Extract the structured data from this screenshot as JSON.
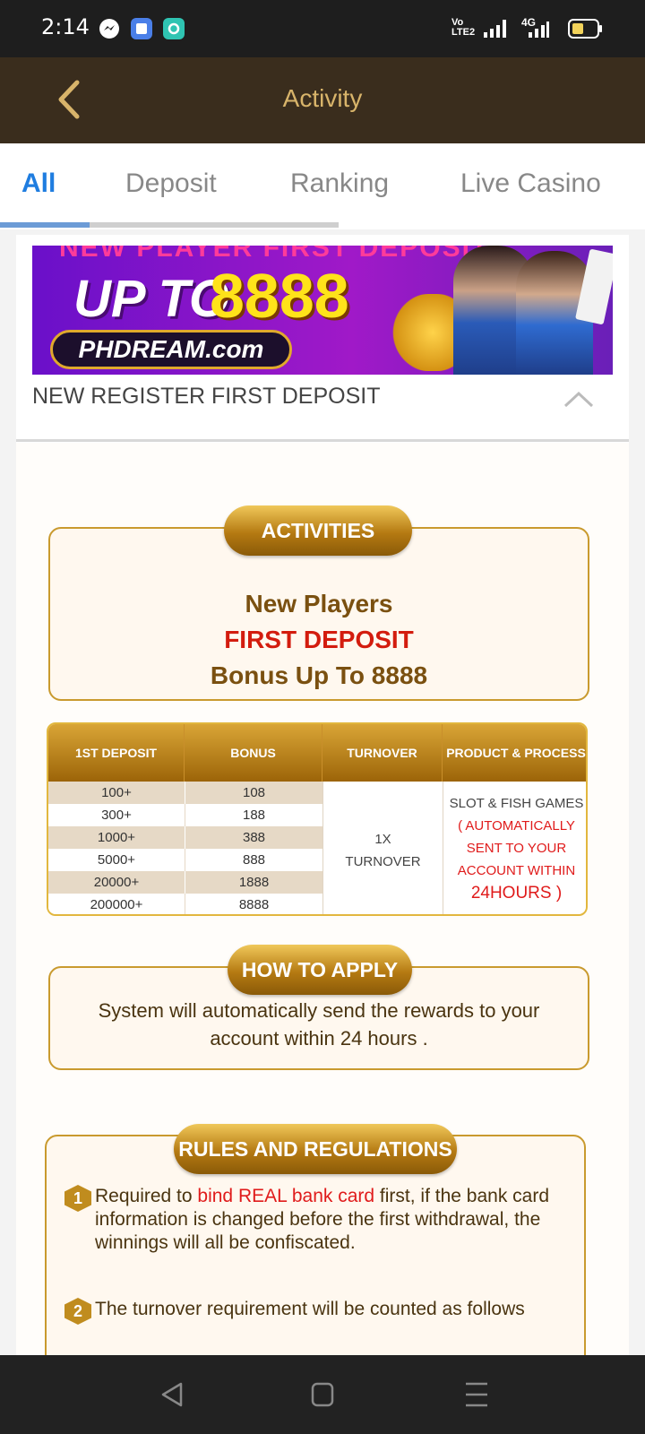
{
  "status_bar": {
    "time": "2:14",
    "network": "4G",
    "volte": "Vo LTE2"
  },
  "header": {
    "title": "Activity"
  },
  "tabs": [
    {
      "label": "All",
      "active": true
    },
    {
      "label": "Deposit",
      "active": false
    },
    {
      "label": "Ranking",
      "active": false
    },
    {
      "label": "Live Casino",
      "active": false
    }
  ],
  "banner": {
    "top_text": "NEW PLAYER FIRST DEPOSIT",
    "upto": "UP TO",
    "amount": "8888",
    "brand": "PHDREAM.com"
  },
  "promo": {
    "title": "NEW REGISTER FIRST DEPOSIT"
  },
  "activities": {
    "badge": "ACTIVITIES",
    "line1": "New Players",
    "line2": "FIRST DEPOSIT",
    "line3": "Bonus Up To 8888"
  },
  "table": {
    "headers": [
      "1ST DEPOSIT",
      "BONUS",
      "TURNOVER",
      "PRODUCT & PROCESS"
    ],
    "rows": [
      {
        "deposit": "100+",
        "bonus": "108"
      },
      {
        "deposit": "300+",
        "bonus": "188"
      },
      {
        "deposit": "1000+",
        "bonus": "388"
      },
      {
        "deposit": "5000+",
        "bonus": "888"
      },
      {
        "deposit": "20000+",
        "bonus": "1888"
      },
      {
        "deposit": "200000+",
        "bonus": "8888"
      }
    ],
    "turnover_l1": "1X",
    "turnover_l2": "TURNOVER",
    "process_l1": "SLOT & FISH GAMES",
    "process_l2": "( AUTOMATICALLY",
    "process_l3": "SENT TO YOUR",
    "process_l4": "ACCOUNT WITHIN",
    "process_l5": "24HOURS )"
  },
  "how_to_apply": {
    "badge": "HOW TO APPLY",
    "line1": "System will automatically send the rewards to your",
    "line2": "account within 24 hours ."
  },
  "rules": {
    "badge": "RULES AND REGULATIONS",
    "items": [
      {
        "num": "1",
        "pre": "Required to ",
        "highlight": "bind REAL bank card",
        "post": " first, if the bank card information is changed before the first withdrawal, the winnings will all be confiscated."
      },
      {
        "num": "2",
        "pre": "The turnover requirement will be counted as follows",
        "highlight": "",
        "post": ""
      }
    ]
  },
  "colors": {
    "header_bg": "#3a2d1d",
    "accent_gold": "#d8b46a",
    "tab_active": "#1f7de0",
    "highlight_red": "#e01b1b"
  }
}
